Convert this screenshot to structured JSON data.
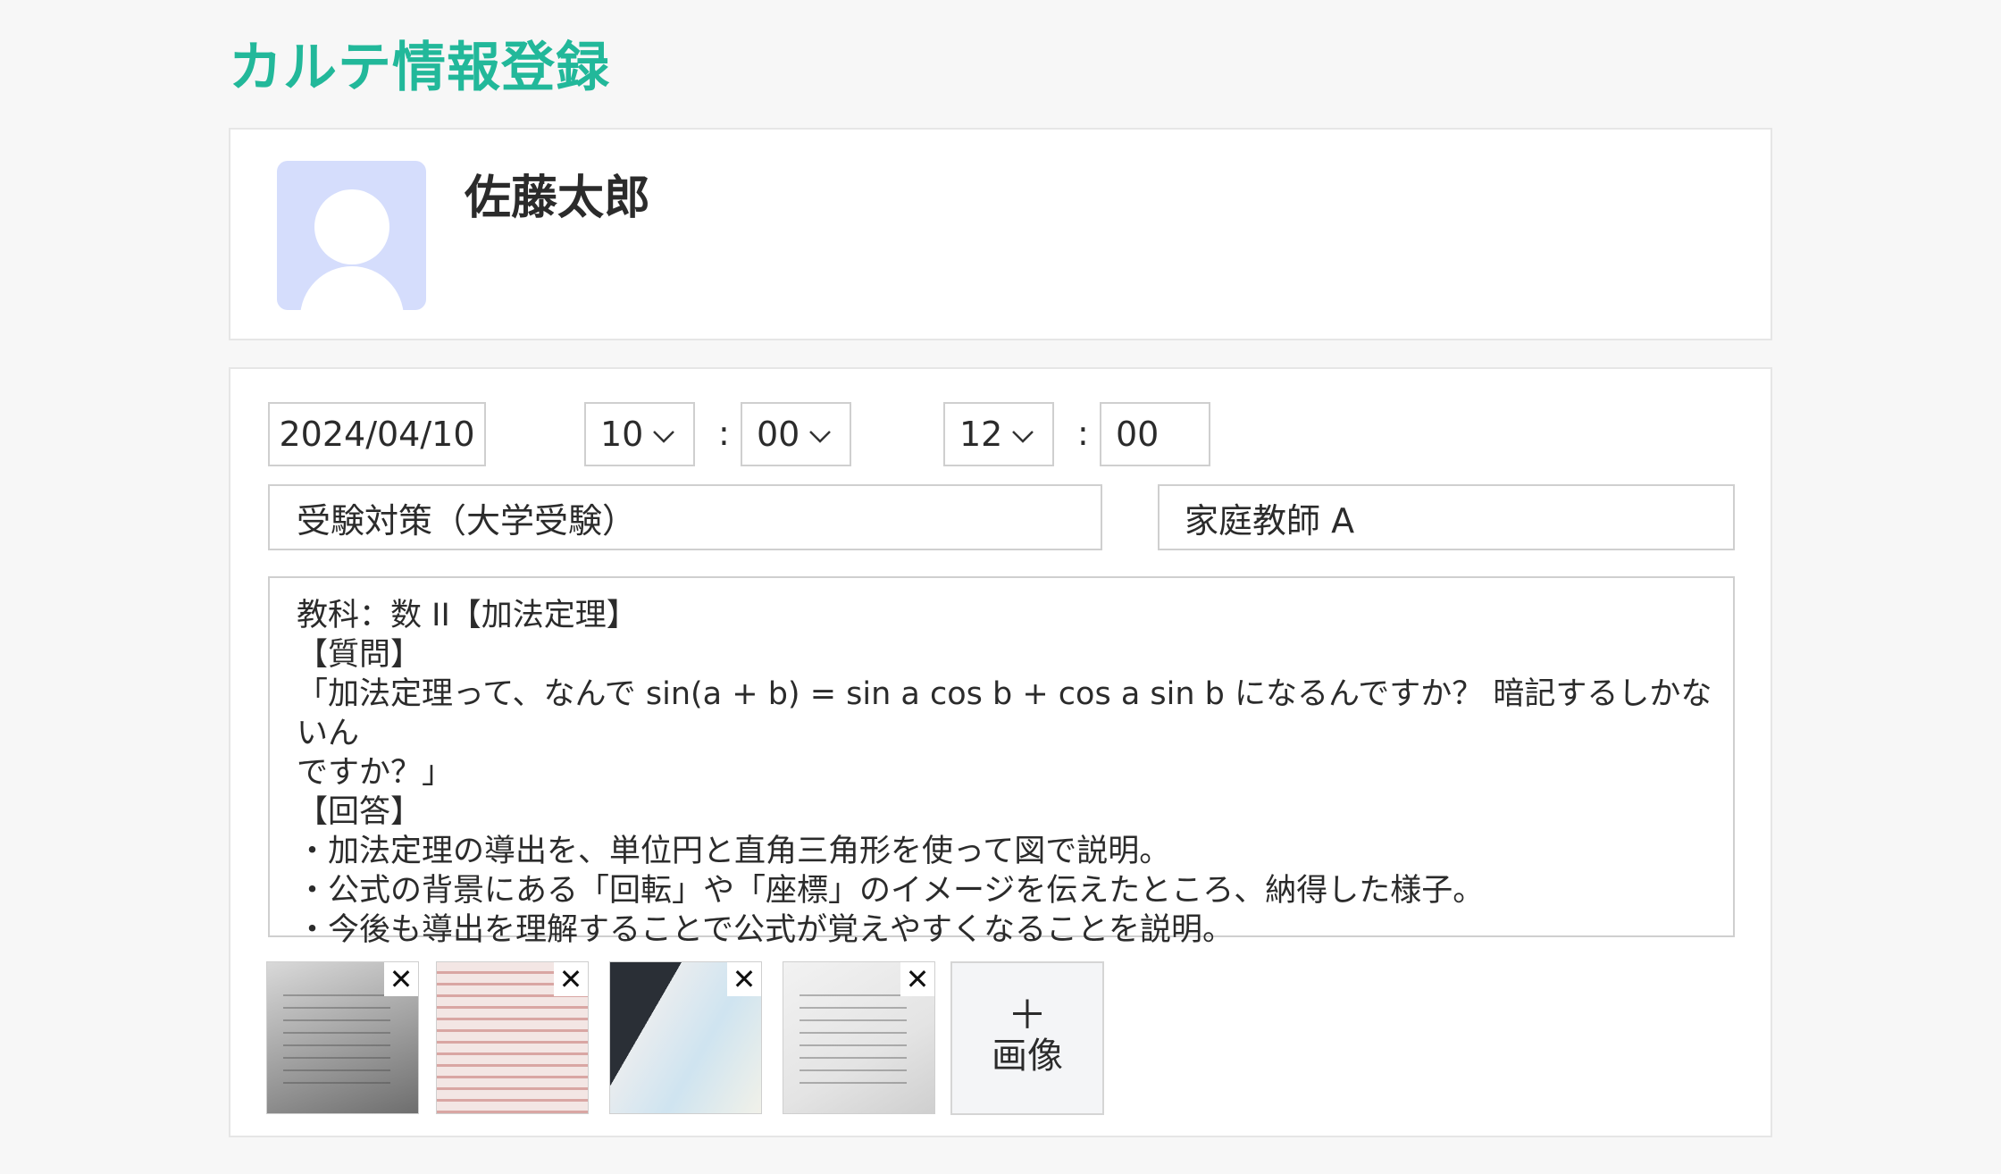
{
  "page": {
    "title": "カルテ情報登録"
  },
  "patient": {
    "name": "佐藤太郎",
    "avatar_icon": "user-silhouette-icon"
  },
  "form": {
    "date": "2024/04/10",
    "start_hour": "10",
    "start_minute": "00",
    "end_hour": "12",
    "end_minute": "00",
    "time_separator": ":",
    "course": "受験対策（大学受験）",
    "teacher": "家庭教師 A",
    "notes": [
      "教科：数 II【加法定理】",
      "【質問】",
      "「加法定理って、なんで sin(a + b) = sin a cos b + cos a sin b になるんですか？ 暗記するしかないん",
      "ですか？」",
      "【回答】",
      "・加法定理の導出を、単位円と直角三角形を使って図で説明。",
      "・公式の背景にある「回転」や「座標」のイメージを伝えたところ、納得した様子。",
      "・今後も導出を理解することで公式が覚えやすくなることを説明。"
    ]
  },
  "images": {
    "remove_label": "✕",
    "add_plus": "＋",
    "add_label": "画像"
  },
  "colors": {
    "accent": "#22b89a",
    "avatar_bg": "#d5ddfc",
    "border": "#cfcfcf"
  }
}
